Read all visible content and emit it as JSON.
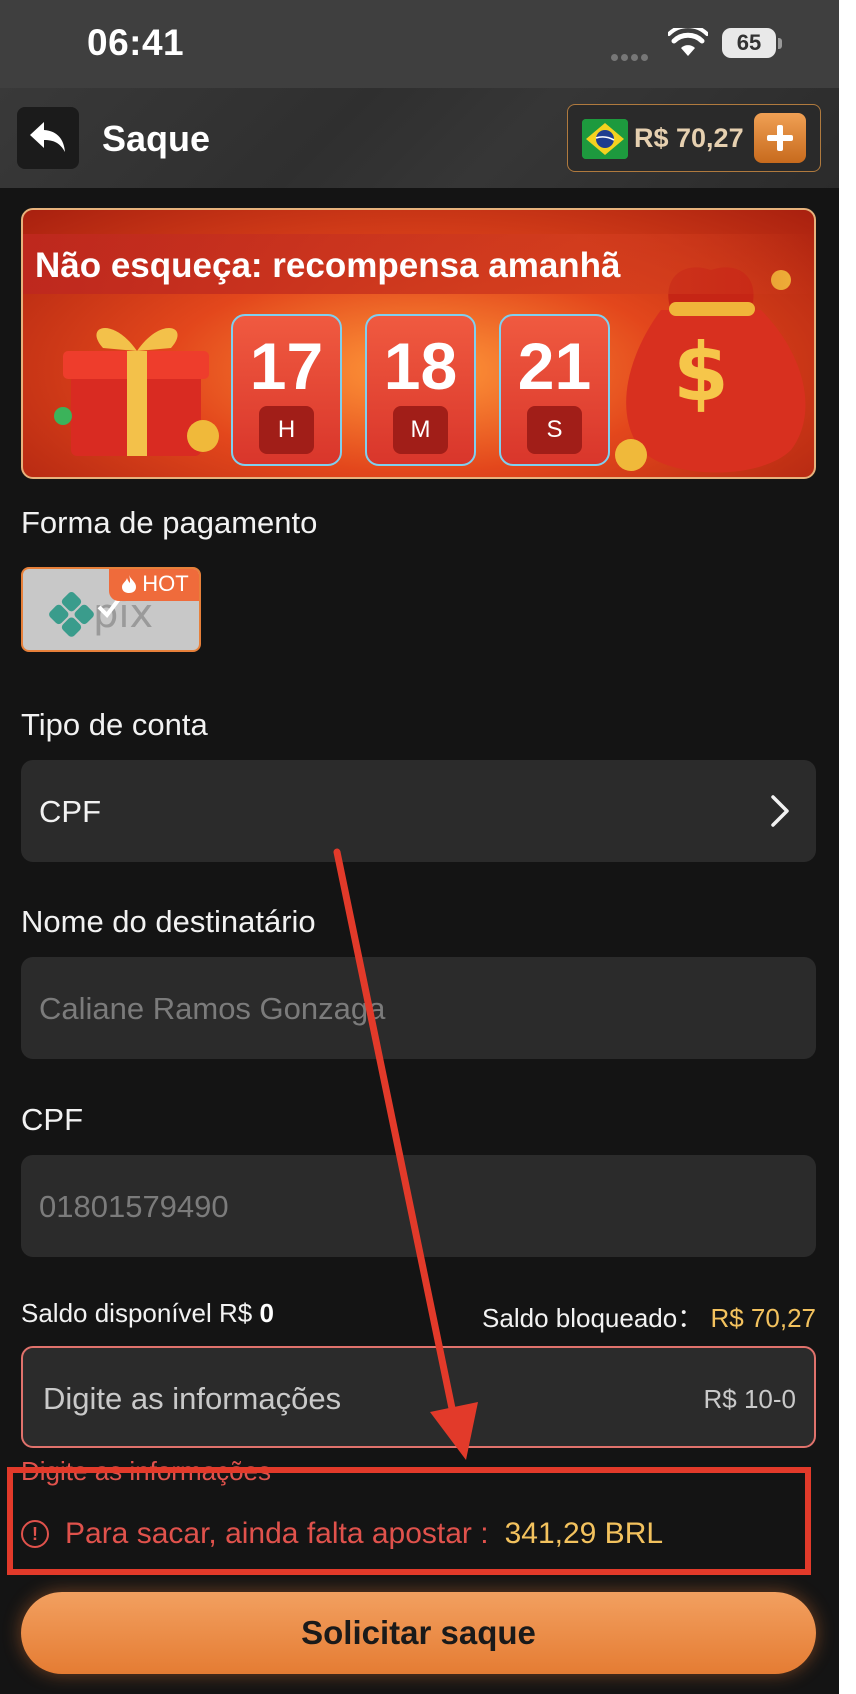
{
  "status_bar": {
    "time": "06:41",
    "battery": "65"
  },
  "header": {
    "title": "Saque",
    "balance": "R$ 70,27"
  },
  "banner": {
    "title": "Não esqueça: recompensa amanhã",
    "countdown": [
      {
        "value": "17",
        "unit": "H"
      },
      {
        "value": "18",
        "unit": "M"
      },
      {
        "value": "21",
        "unit": "S"
      }
    ]
  },
  "payment": {
    "label": "Forma de pagamento",
    "method": "pix",
    "badge": "HOT"
  },
  "account_type": {
    "label": "Tipo de conta",
    "value": "CPF"
  },
  "recipient": {
    "label": "Nome do destinatário",
    "value": "Caliane Ramos Gonzaga"
  },
  "cpf": {
    "label": "CPF",
    "value": "01801579490"
  },
  "balances": {
    "available_label": "Saldo disponível R$",
    "available_value": "0",
    "blocked_label": "Saldo bloqueado：",
    "blocked_value": "R$ 70,27"
  },
  "amount": {
    "placeholder": "Digite as informações",
    "range": "R$ 10-0"
  },
  "error": "Digite as informações",
  "warning": {
    "text": "Para sacar, ainda falta apostar :",
    "amount": "341,29 BRL"
  },
  "submit_label": "Solicitar saque",
  "colors": {
    "accent": "#e57c33",
    "warning": "#e0524c",
    "gold": "#f3c25e",
    "annotation": "#e23a2a"
  }
}
